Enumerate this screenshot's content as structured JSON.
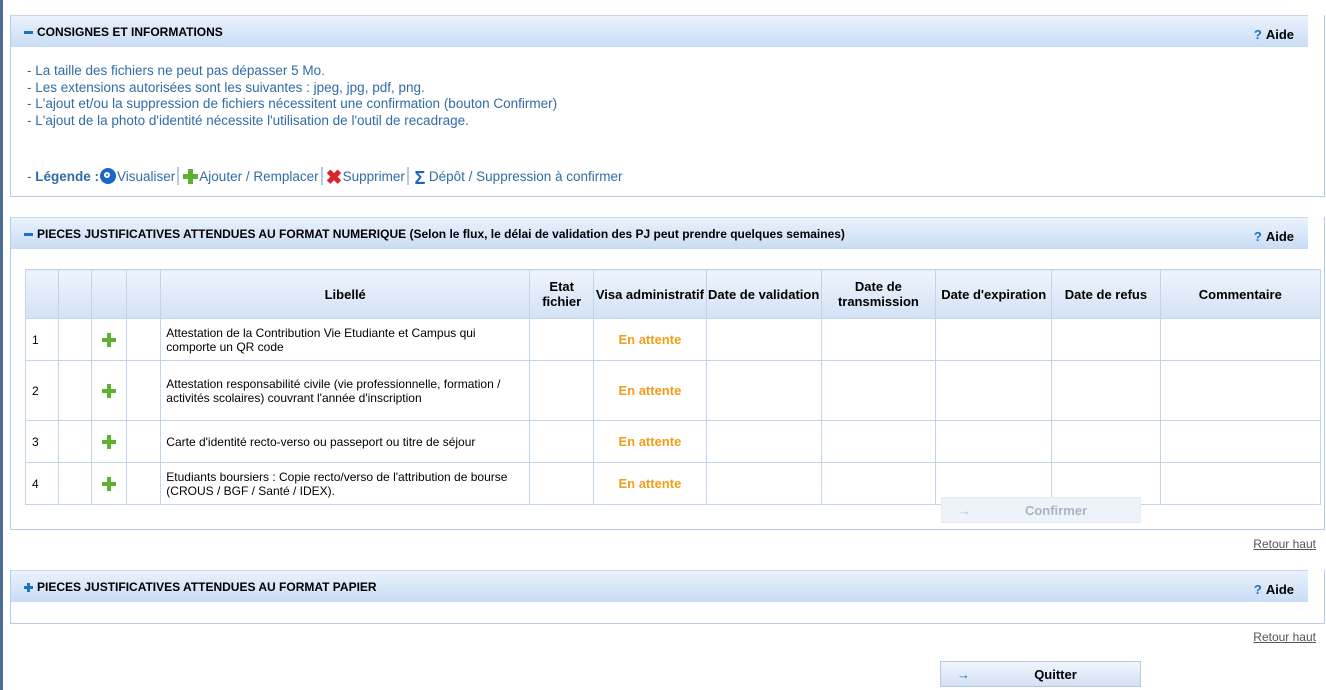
{
  "consignes": {
    "title": "CONSIGNES ET INFORMATIONS",
    "help": "Aide",
    "help_mark": "?",
    "lines": [
      "- La taille des fichiers ne peut pas dépasser 5 Mo.",
      "- Les extensions autorisées sont les suivantes : jpeg, jpg, pdf, png.",
      "- L'ajout et/ou la suppression de fichiers nécessitent une confirmation (bouton Confirmer)",
      "- L'ajout de la photo d'identité nécessite l'utilisation de l'outil de recadrage."
    ],
    "legend_prefix": "- ",
    "legend_label": "Légende :",
    "legend_items": [
      "Visualiser",
      "Ajouter / Remplacer",
      "Supprimer",
      "Dépôt / Suppression à confirmer"
    ]
  },
  "numerique": {
    "title": "PIECES JUSTIFICATIVES ATTENDUES AU FORMAT NUMERIQUE (Selon le flux, le délai de validation des PJ peut prendre quelques semaines)",
    "help": "Aide",
    "help_mark": "?",
    "columns": {
      "libelle": "Libellé",
      "etat": "Etat fichier",
      "visa": "Visa administratif",
      "validation": "Date de validation",
      "transmission": "Date de transmission",
      "expiration": "Date d'expiration",
      "refus": "Date de refus",
      "commentaire": "Commentaire"
    },
    "rows": [
      {
        "num": "1",
        "libelle": "Attestation de la Contribution Vie Etudiante et Campus qui comporte un QR code",
        "visa": "En attente"
      },
      {
        "num": "2",
        "libelle": "Attestation responsabilité civile (vie professionnelle, formation / activités scolaires) couvrant l'année d'inscription",
        "visa": "En attente"
      },
      {
        "num": "3",
        "libelle": "Carte d'identité recto-verso ou passeport ou titre de séjour",
        "visa": "En attente"
      },
      {
        "num": "4",
        "libelle": "Etudiants boursiers : Copie recto/verso de l'attribution de bourse (CROUS / BGF / Santé / IDEX).",
        "visa": "En attente"
      }
    ],
    "confirm_label": "Confirmer",
    "arrow": "→"
  },
  "retour_haut": "Retour haut",
  "papier": {
    "title": "PIECES JUSTIFICATIVES ATTENDUES AU FORMAT PAPIER",
    "help": "Aide",
    "help_mark": "?"
  },
  "quit_label": "Quitter",
  "quit_arrow": "→"
}
